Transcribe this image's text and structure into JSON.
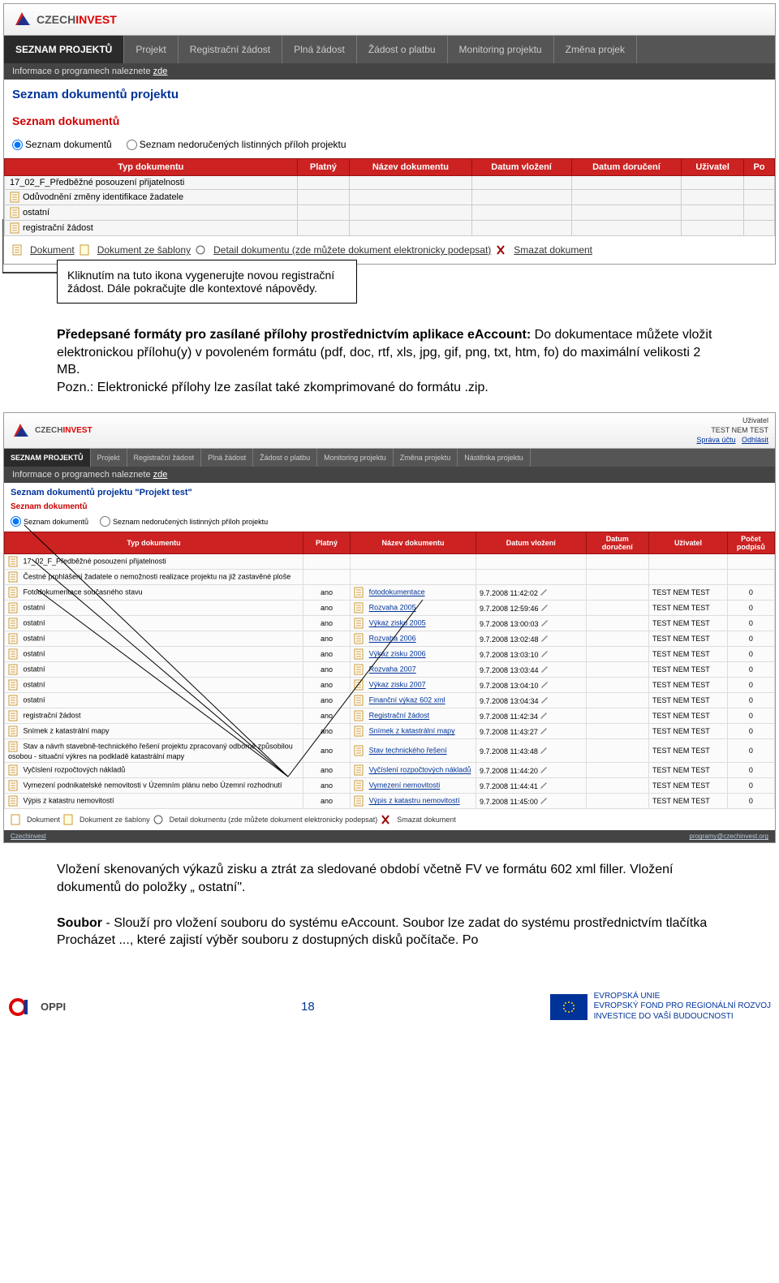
{
  "logo": {
    "part1": "CZECH",
    "part2": "INVEST"
  },
  "ss1": {
    "nav": [
      "SEZNAM PROJEKTŮ",
      "Projekt",
      "Registrační žádost",
      "Plná žádost",
      "Žádost o platbu",
      "Monitoring projektu",
      "Změna projek"
    ],
    "subnav_text": "Informace o programech naleznete ",
    "subnav_link": "zde",
    "title": "Seznam dokumentů projektu",
    "red": "Seznam dokumentů",
    "radio1": "Seznam dokumentů",
    "radio2": "Seznam nedoručených listinných příloh projektu",
    "cols": [
      "Typ dokumentu",
      "Platný",
      "Název dokumentu",
      "Datum vložení",
      "Datum doručení",
      "Uživatel",
      "Po"
    ],
    "rows": [
      "17_02_F_Předběžné posouzení přijatelnosti",
      "Odůvodnění změny identifikace žadatele",
      "ostatní",
      "registrační žádost"
    ],
    "links": [
      "Dokument",
      "Dokument ze šablony",
      "Detail dokumentu (zde můžete dokument elektronicky podepsat)",
      "Smazat dokument"
    ]
  },
  "callout": "Kliknutím na tuto ikona vygenerujte novou registrační žádost. Dále pokračujte dle kontextové nápovědy.",
  "para1_bold": "Předepsané formáty pro zasílané přílohy prostřednictvím aplikace eAccount:",
  "para1_rest": " Do dokumentace můžete vložit elektronickou přílohu(y) v povoleném formátu (pdf, doc, rtf, xls, jpg, gif, png, txt, htm, fo) do maximální velikosti 2 MB.",
  "para1_pozn": "Pozn.: Elektronické přílohy lze zasílat také zkomprimované do formátu .zip.",
  "ss2": {
    "user_label": "Uživatel",
    "user_name": "TEST NEM TEST",
    "user_acct": "Správa účtu",
    "user_logout": "Odhlásit",
    "nav": [
      "SEZNAM PROJEKTŮ",
      "Projekt",
      "Registrační žádost",
      "Plná žádost",
      "Žádost o platbu",
      "Monitoring projektu",
      "Změna projektu",
      "Nástěnka projektu"
    ],
    "subnav_text": "Informace o programech naleznete ",
    "subnav_link": "zde",
    "title": "Seznam dokumentů projektu \"Projekt test\"",
    "red": "Seznam dokumentů",
    "radio1": "Seznam dokumentů",
    "radio2": "Seznam nedoručených listinných příloh projektu",
    "cols": [
      "Typ dokumentu",
      "Platný",
      "Název dokumentu",
      "Datum vložení",
      "Datum doručení",
      "Uživatel",
      "Počet podpisů"
    ],
    "rows": [
      {
        "doc": "17_02_F_Předběžné posouzení přijatelnosti",
        "platny": "",
        "nazev": "",
        "datum": "",
        "uziv": "",
        "pod": ""
      },
      {
        "doc": "Čestné prohlášení žadatele o nemožnosti realizace projektu na již zastavěné ploše",
        "platny": "",
        "nazev": "",
        "datum": "",
        "uziv": "",
        "pod": ""
      },
      {
        "doc": "Fotodokumentace současného stavu",
        "platny": "ano",
        "nazev": "fotodokumentace",
        "datum": "9.7.2008 11:42:02",
        "uziv": "TEST NEM TEST",
        "pod": "0"
      },
      {
        "doc": "ostatní",
        "platny": "ano",
        "nazev": "Rozvaha 2005",
        "datum": "9.7.2008 12:59:46",
        "uziv": "TEST NEM TEST",
        "pod": "0"
      },
      {
        "doc": "ostatní",
        "platny": "ano",
        "nazev": "Výkaz zisku 2005",
        "datum": "9.7.2008 13:00:03",
        "uziv": "TEST NEM TEST",
        "pod": "0"
      },
      {
        "doc": "ostatní",
        "platny": "ano",
        "nazev": "Rozvaha 2006",
        "datum": "9.7.2008 13:02:48",
        "uziv": "TEST NEM TEST",
        "pod": "0"
      },
      {
        "doc": "ostatní",
        "platny": "ano",
        "nazev": "Výkaz zisku 2006",
        "datum": "9.7.2008 13:03:10",
        "uziv": "TEST NEM TEST",
        "pod": "0"
      },
      {
        "doc": "ostatní",
        "platny": "ano",
        "nazev": "Rozvaha 2007",
        "datum": "9.7.2008 13:03:44",
        "uziv": "TEST NEM TEST",
        "pod": "0"
      },
      {
        "doc": "ostatní",
        "platny": "ano",
        "nazev": "Výkaz zisku 2007",
        "datum": "9.7.2008 13:04:10",
        "uziv": "TEST NEM TEST",
        "pod": "0"
      },
      {
        "doc": "ostatní",
        "platny": "ano",
        "nazev": "Finanční výkaz 602 xml",
        "datum": "9.7.2008 13:04:34",
        "uziv": "TEST NEM TEST",
        "pod": "0"
      },
      {
        "doc": "registrační žádost",
        "platny": "ano",
        "nazev": "Registrační žádost",
        "datum": "9.7.2008 11:42:34",
        "uziv": "TEST NEM TEST",
        "pod": "0"
      },
      {
        "doc": "Snímek z katastrální mapy",
        "platny": "ano",
        "nazev": "Snímek z katastrální mapy",
        "datum": "9.7.2008 11:43:27",
        "uziv": "TEST NEM TEST",
        "pod": "0"
      },
      {
        "doc": "Stav a návrh stavebně-technického řešení projektu zpracovaný odborně způsobilou osobou - situační výkres na podkladě katastrální mapy",
        "platny": "ano",
        "nazev": "Stav technického řešení",
        "datum": "9.7.2008 11:43:48",
        "uziv": "TEST NEM TEST",
        "pod": "0"
      },
      {
        "doc": "Vyčíslení rozpočtových nákladů",
        "platny": "ano",
        "nazev": "Vyčíslení rozpočtových nákladů",
        "datum": "9.7.2008 11:44:20",
        "uziv": "TEST NEM TEST",
        "pod": "0"
      },
      {
        "doc": "Vymezení podnikatelské nemovitosti v Územním plánu nebo Územní rozhodnutí",
        "platny": "ano",
        "nazev": "Vymezení nemovitosti",
        "datum": "9.7.2008 11:44:41",
        "uziv": "TEST NEM TEST",
        "pod": "0"
      },
      {
        "doc": "Výpis z katastru nemovitostí",
        "platny": "ano",
        "nazev": "Výpis z katastru nemovitostí",
        "datum": "9.7.2008 11:45:00",
        "uziv": "TEST NEM TEST",
        "pod": "0"
      }
    ],
    "links": [
      "Dokument",
      "Dokument ze šablony",
      "Detail dokumentu (zde můžete dokument elektronicky podepsat)",
      "Smazat dokument"
    ],
    "footer_left": "Czechinvest",
    "footer_right": "programy@czechinvest.org"
  },
  "para2a": "Vložení skenovaných výkazů zisku a ztrát za sledované období včetně FV ve formátu 602 xml filler. Vložení dokumentů do položky „ ostatní\".",
  "para2b_bold": "Soubor",
  "para2b_rest": " - Slouží pro vložení souboru do systému eAccount. Soubor lze zadat do systému prostřednictvím tlačítka  Procházet ..., které zajistí výběr souboru z dostupných disků počítače. Po",
  "footer": {
    "oppi": "OPPI",
    "page": "18",
    "eu1": "EVROPSKÁ UNIE",
    "eu2": "EVROPSKÝ FOND PRO REGIONÁLNÍ ROZVOJ",
    "eu3": "INVESTICE DO VAŠÍ BUDOUCNOSTI"
  }
}
